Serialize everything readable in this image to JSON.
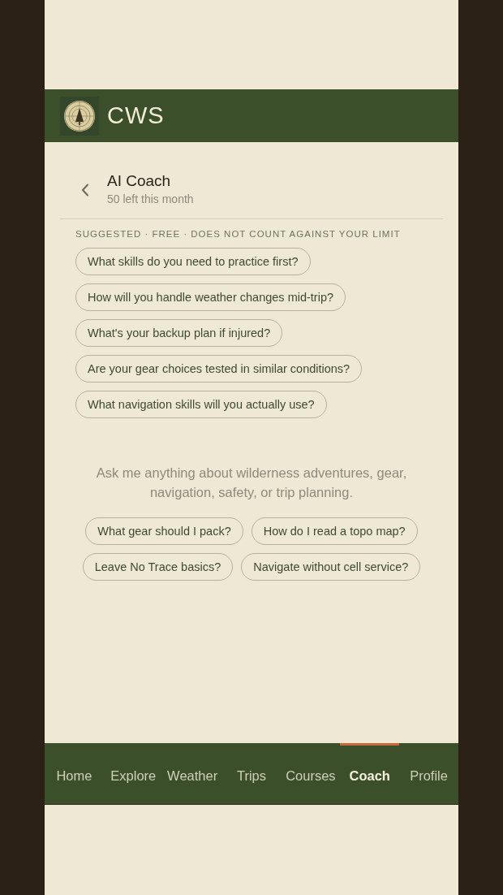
{
  "header": {
    "title": "CWS"
  },
  "coach": {
    "title": "AI Coach",
    "subtitle": "50 left this month"
  },
  "suggested": {
    "label": "SUGGESTED · FREE · DOES NOT COUNT AGAINST YOUR LIMIT",
    "chips": [
      "What skills do you need to practice first?",
      "How will you handle weather changes mid-trip?",
      "What's your backup plan if injured?",
      "Are your gear choices tested in similar conditions?",
      "What navigation skills will you actually use?"
    ]
  },
  "intro": {
    "text": "Ask me anything about wilderness adventures, gear, navigation, safety, or trip planning.",
    "starters": [
      "What gear should I pack?",
      "How do I read a topo map?",
      "Leave No Trace basics?",
      "Navigate without cell service?"
    ]
  },
  "nav": {
    "tabs": [
      {
        "label": "Home",
        "selected": false
      },
      {
        "label": "Explore",
        "selected": false
      },
      {
        "label": "Weather",
        "selected": false
      },
      {
        "label": "Trips",
        "selected": false
      },
      {
        "label": "Courses",
        "selected": false
      },
      {
        "label": "Coach",
        "selected": true
      },
      {
        "label": "Profile",
        "selected": false
      }
    ]
  }
}
